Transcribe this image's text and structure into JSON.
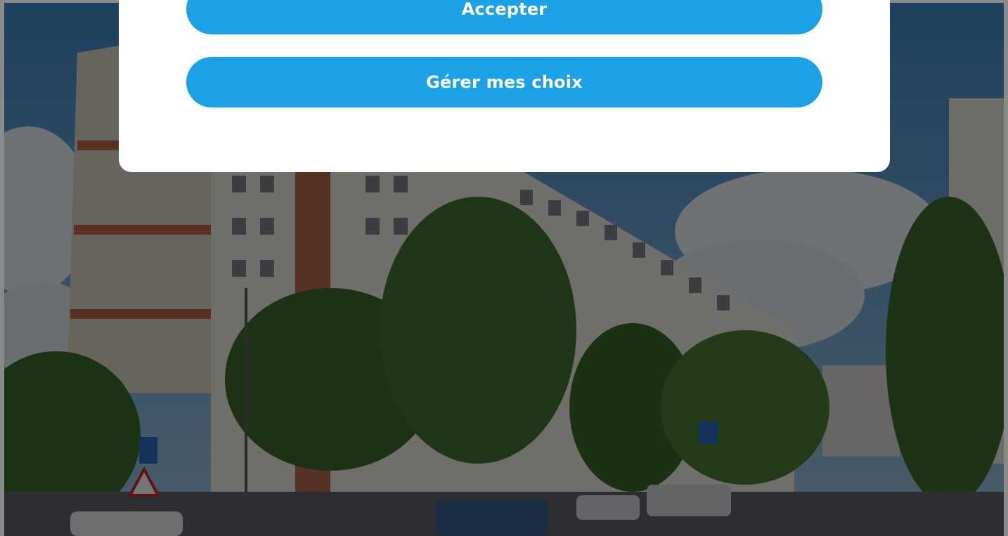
{
  "consent_modal": {
    "accept_label": "Accepter",
    "manage_label": "Gérer mes choix"
  },
  "colors": {
    "button_background": "#1da1e6",
    "button_text": "#ffffff",
    "modal_background": "#ffffff"
  }
}
